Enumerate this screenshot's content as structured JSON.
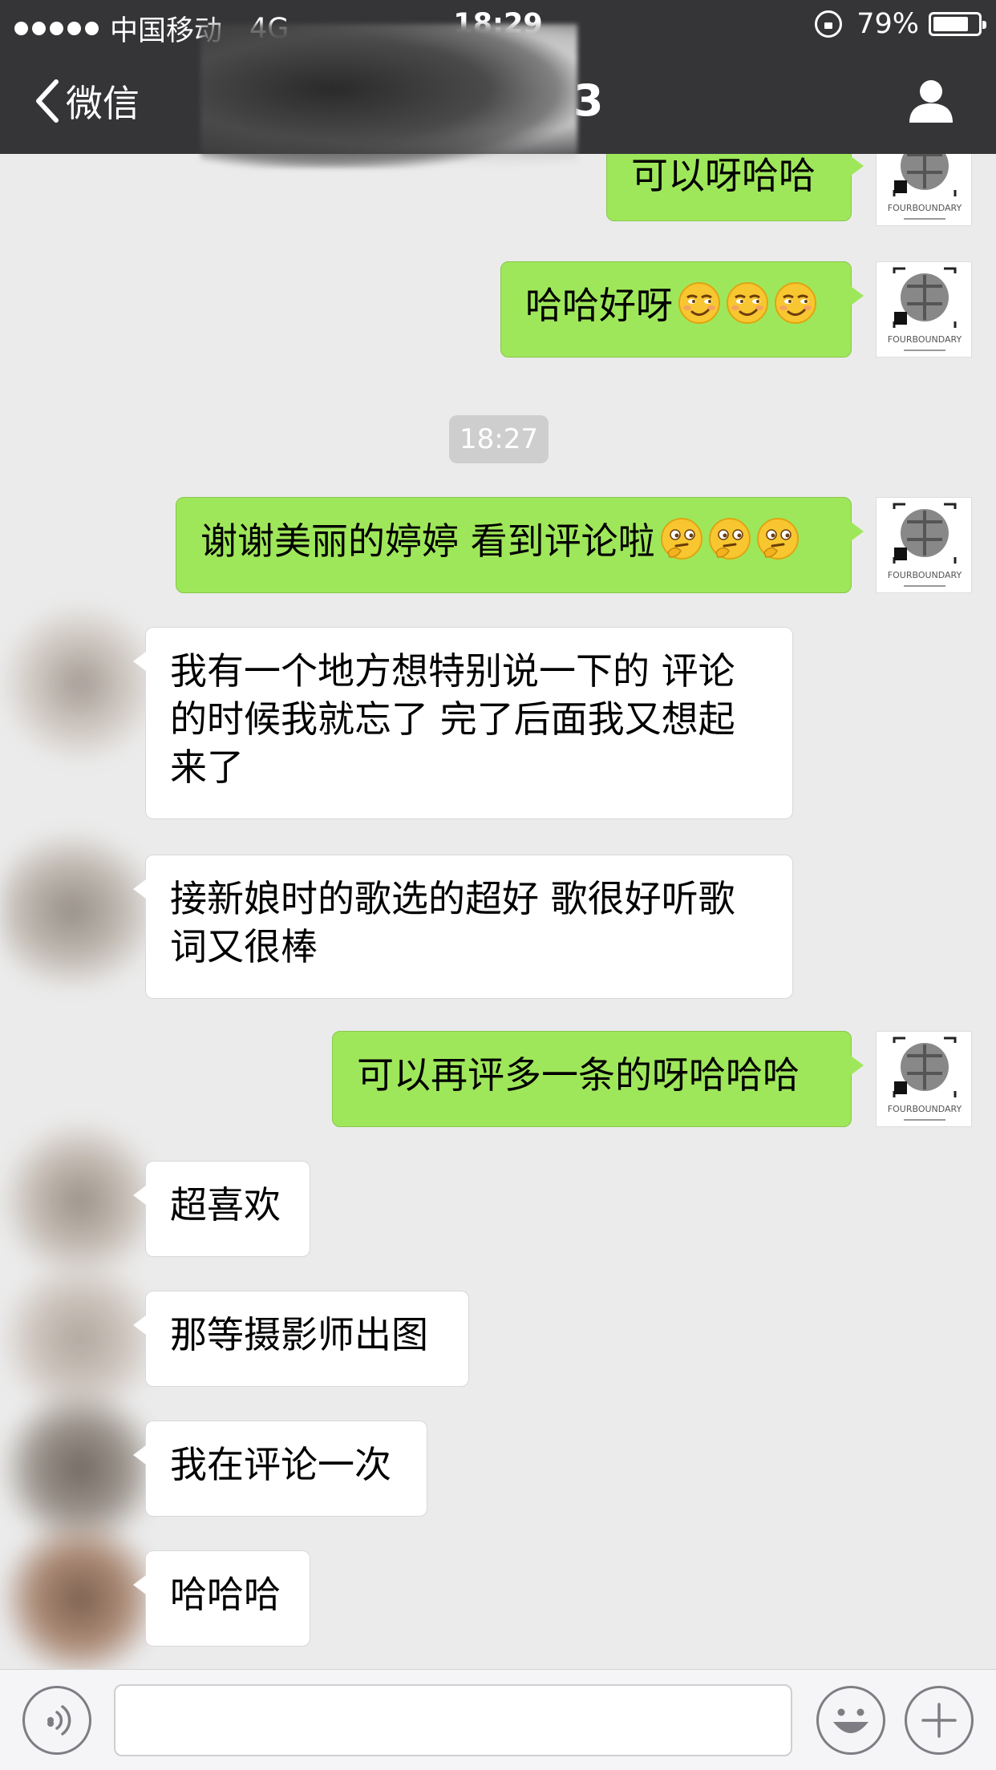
{
  "status_bar": {
    "carrier": "中国移动",
    "network": "4G",
    "time": "18:29",
    "battery_text": "79%",
    "battery_level": 0.79
  },
  "nav": {
    "back_label": "微信",
    "title": "0171223"
  },
  "avatar_brand": {
    "name": "FOURBOUNDARY"
  },
  "messages": [
    {
      "id": "m1",
      "side": "out",
      "text": "可以呀哈哈"
    },
    {
      "id": "m2",
      "side": "out",
      "text": "哈哈好呀",
      "emoji": [
        "smirk-face",
        "smirk-face",
        "smirk-face"
      ]
    },
    {
      "id": "t1",
      "type": "timestamp",
      "text": "18:27"
    },
    {
      "id": "m3",
      "side": "out",
      "text": "谢谢美丽的婷婷 看到评论啦",
      "emoji": [
        "thinking-face",
        "thinking-face",
        "thinking-face"
      ]
    },
    {
      "id": "m4",
      "side": "in",
      "lines": [
        "我有一个地方想特别说一下的 评论",
        "的时候我就忘了 完了后面我又想起",
        "来了"
      ]
    },
    {
      "id": "m5",
      "side": "in",
      "lines": [
        "接新娘时的歌选的超好 歌很好听歌",
        "词又很棒"
      ]
    },
    {
      "id": "m6",
      "side": "out",
      "text": "可以再评多一条的呀哈哈哈"
    },
    {
      "id": "m7",
      "side": "in",
      "text": "超喜欢"
    },
    {
      "id": "m8",
      "side": "in",
      "text": "那等摄影师出图"
    },
    {
      "id": "m9",
      "side": "in",
      "text": "我在评论一次"
    },
    {
      "id": "m10",
      "side": "in",
      "text": "哈哈哈"
    }
  ],
  "input": {
    "value": "",
    "icons": [
      "voice-icon",
      "emoji-icon",
      "plus-icon"
    ]
  },
  "colors": {
    "nav_bg": "#353538",
    "chat_bg": "#ebebeb",
    "outgoing_bubble": "#9fe75a",
    "incoming_bubble": "#ffffff"
  }
}
